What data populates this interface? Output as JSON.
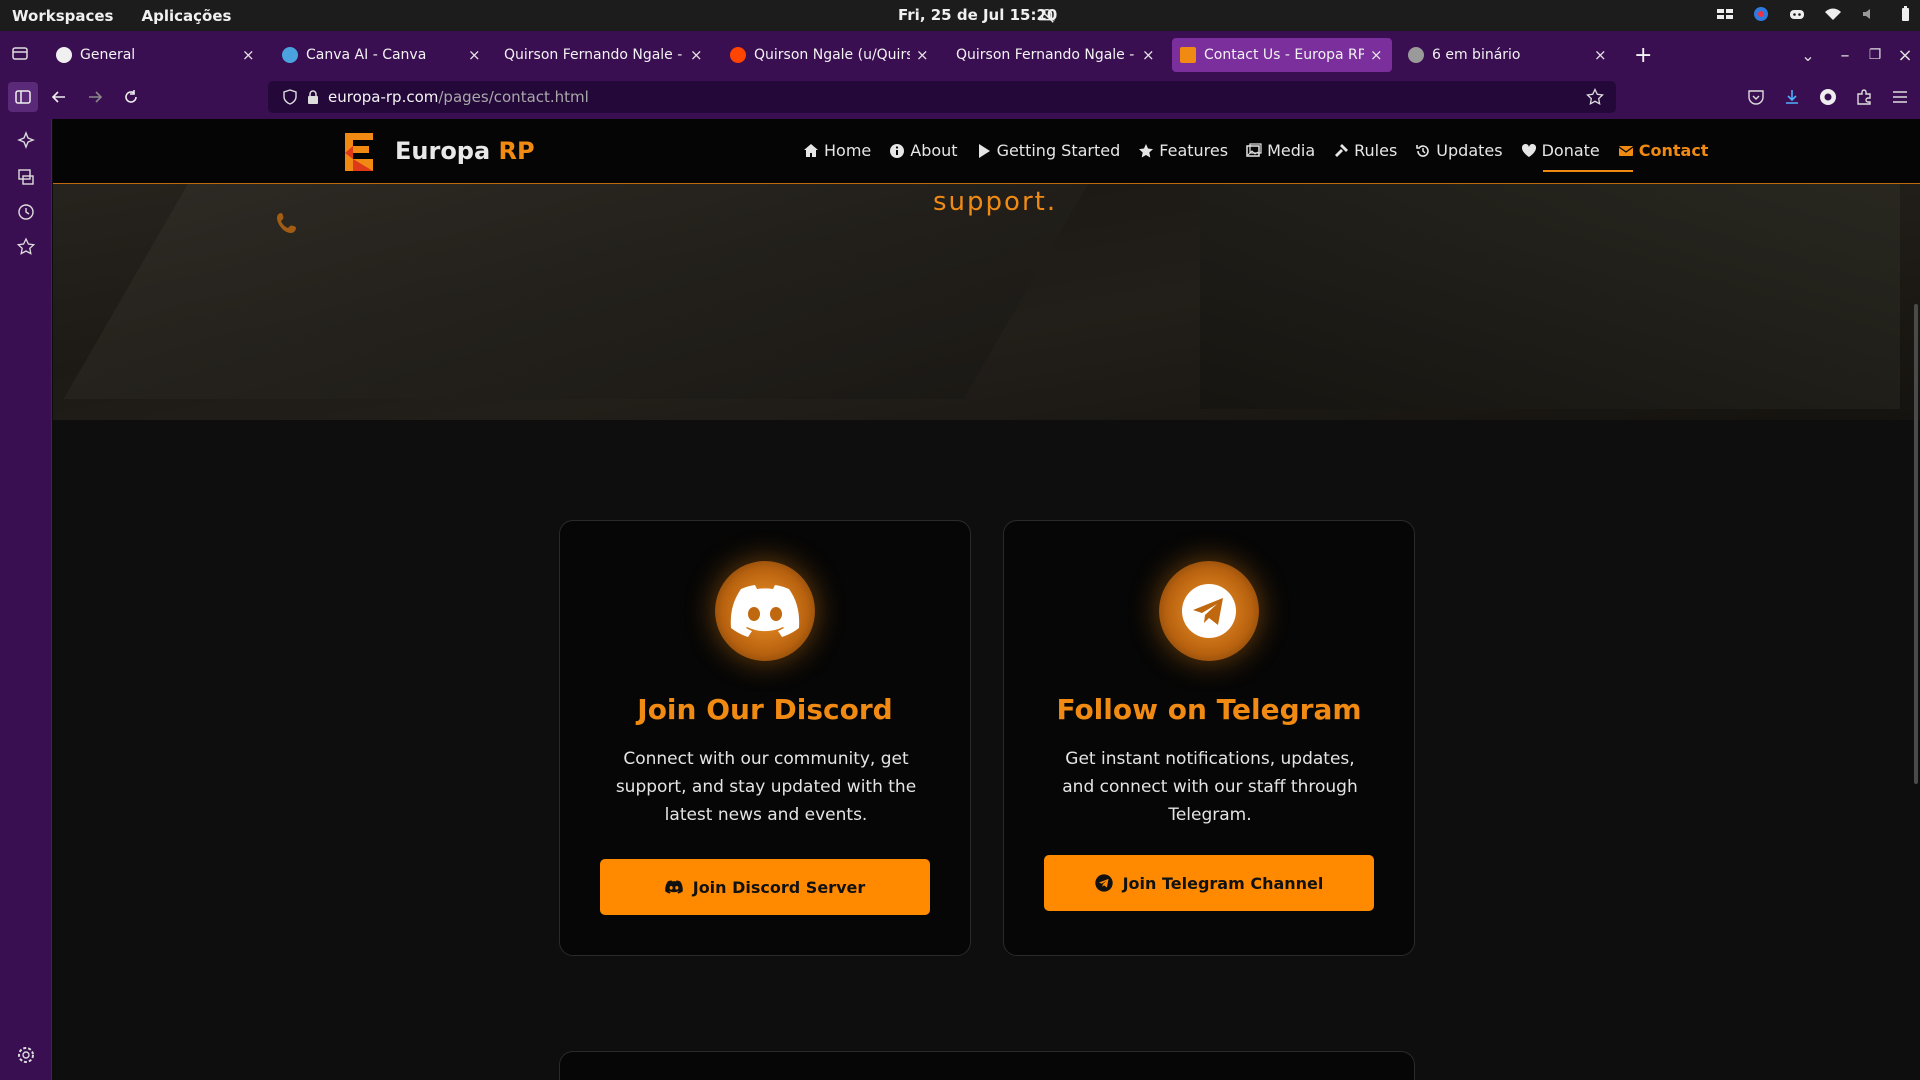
{
  "system": {
    "workspaces": "Workspaces",
    "apps": "Aplicações",
    "datetime": "Fri, 25 de Jul  15:20"
  },
  "tabs": [
    {
      "title": "General",
      "favicon_color": "#f0f0f0"
    },
    {
      "title": "Canva AI - Canva",
      "favicon_color": "#4aa3df"
    },
    {
      "title": "Quirson Fernando Ngale - Full S",
      "favicon_color": "#3a0f52"
    },
    {
      "title": "Quirson Ngale (u/Quirson_N",
      "favicon_color": "#ff4500"
    },
    {
      "title": "Quirson Fernando Ngale - Dese",
      "favicon_color": "#3a0f52"
    },
    {
      "title": "Contact Us - Europa RP",
      "favicon_color": "#f08a12"
    },
    {
      "title": "6 em binário",
      "favicon_color": "#9a9a9a"
    }
  ],
  "url": {
    "host": "europa-rp.com",
    "path": "/pages/contact.html"
  },
  "site": {
    "brand_name": "Europa",
    "brand_suffix": "RP",
    "nav": [
      {
        "label": "Home",
        "icon": "home-icon"
      },
      {
        "label": "About",
        "icon": "info-icon"
      },
      {
        "label": "Getting Started",
        "icon": "play-icon"
      },
      {
        "label": "Features",
        "icon": "star-icon"
      },
      {
        "label": "Media",
        "icon": "images-icon"
      },
      {
        "label": "Rules",
        "icon": "gavel-icon"
      },
      {
        "label": "Updates",
        "icon": "history-icon"
      },
      {
        "label": "Donate",
        "icon": "heart-icon"
      },
      {
        "label": "Contact",
        "icon": "envelope-icon"
      }
    ],
    "hero_text": "support."
  },
  "cards": {
    "discord": {
      "title": "Join Our Discord",
      "text": "Connect with our community, get support, and stay updated with the latest news and events.",
      "button": "Join Discord Server"
    },
    "telegram": {
      "title": "Follow on Telegram",
      "text": "Get instant notifications, updates, and connect with our staff through Telegram.",
      "button": "Join Telegram Channel"
    }
  },
  "colors": {
    "accent": "#f08a12",
    "button": "#ff8a00",
    "browser_chrome": "#3a0f52"
  }
}
